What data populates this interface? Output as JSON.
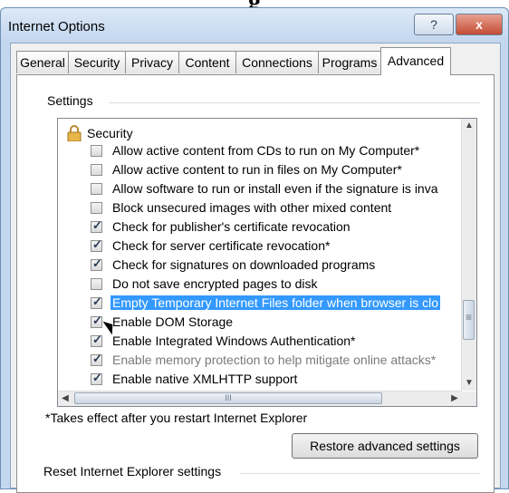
{
  "partial_heading": "g",
  "window": {
    "title": "Internet Options",
    "help_label": "?",
    "close_label": "x"
  },
  "tabs": [
    {
      "label": "General"
    },
    {
      "label": "Security"
    },
    {
      "label": "Privacy"
    },
    {
      "label": "Content"
    },
    {
      "label": "Connections"
    },
    {
      "label": "Programs"
    },
    {
      "label": "Advanced",
      "active": true
    }
  ],
  "settings": {
    "group_label": "Settings",
    "category": "Security",
    "items": [
      {
        "label": "Allow active content from CDs to run on My Computer*",
        "checked": false
      },
      {
        "label": "Allow active content to run in files on My Computer*",
        "checked": false
      },
      {
        "label": "Allow software to run or install even if the signature is inva",
        "checked": false
      },
      {
        "label": "Block unsecured images with other mixed content",
        "checked": false
      },
      {
        "label": "Check for publisher's certificate revocation",
        "checked": true
      },
      {
        "label": "Check for server certificate revocation*",
        "checked": true
      },
      {
        "label": "Check for signatures on downloaded programs",
        "checked": true
      },
      {
        "label": "Do not save encrypted pages to disk",
        "checked": false
      },
      {
        "label": "Empty Temporary Internet Files folder when browser is clo",
        "checked": true,
        "selected": true
      },
      {
        "label": "Enable DOM Storage",
        "checked": true
      },
      {
        "label": "Enable Integrated Windows Authentication*",
        "checked": true
      },
      {
        "label": "Enable memory protection to help mitigate online attacks*",
        "checked": true,
        "disabled": true
      },
      {
        "label": "Enable native XMLHTTP support",
        "checked": true
      }
    ],
    "hscroll_grip": "III"
  },
  "note": "*Takes effect after you restart Internet Explorer",
  "restore_button": "Restore advanced settings",
  "reset_group_label": "Reset Internet Explorer settings",
  "colors": {
    "selection": "#3399ff",
    "window_frame": "#c3d7ee"
  }
}
